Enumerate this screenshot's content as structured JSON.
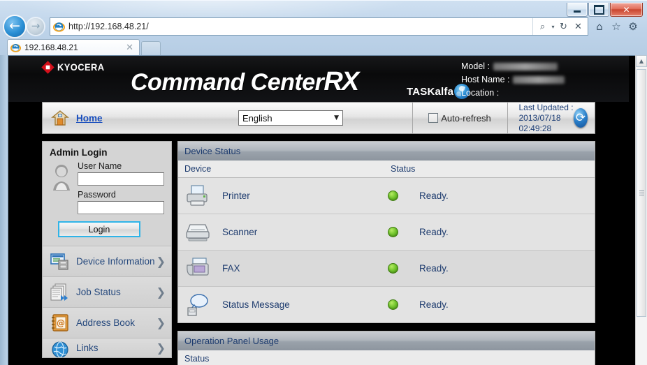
{
  "browser": {
    "window_controls": {
      "minimize": "minimize",
      "maximize": "maximize",
      "close": "✕"
    },
    "back_glyph": "←",
    "forward_glyph": "→",
    "address_value": "http://192.168.48.21/",
    "address_tools": {
      "search": "⌕",
      "dropdown": "▾",
      "refresh": "↻",
      "stop": "✕"
    },
    "toolbar_icons": {
      "home": "⌂",
      "favorites": "☆",
      "settings": "⚙"
    },
    "tab": {
      "title": "192.168.48.21",
      "close": "✕"
    },
    "newtab_label": ""
  },
  "header": {
    "brand": "KYOCERA",
    "product_title": "Command Center",
    "product_rx": "RX",
    "series": "TASKalfa",
    "meta": [
      {
        "label": "Model :",
        "value_redacted": true,
        "redacted_width": 92
      },
      {
        "label": "Host Name :",
        "value_redacted": true,
        "redacted_width": 74
      },
      {
        "label": "Location :",
        "value_redacted": false,
        "redacted_width": 0
      }
    ]
  },
  "toolbar": {
    "home_label": "Home",
    "language_selected": "English",
    "language_caret": "▼",
    "autorefresh_label": "Auto-refresh",
    "autorefresh_checked": false,
    "last_updated_label": "Last Updated :",
    "last_updated_value": "2013/07/18 02:49:28",
    "refresh_glyph": "⟳"
  },
  "sidebar": {
    "login": {
      "title": "Admin Login",
      "username_label": "User Name",
      "username_value": "",
      "password_label": "Password",
      "password_value": "",
      "login_button": "Login"
    },
    "items": [
      {
        "label": "Device Information",
        "icon": "device-information-icon",
        "chevron": "❯"
      },
      {
        "label": "Job Status",
        "icon": "job-status-icon",
        "chevron": "❯"
      },
      {
        "label": "Address Book",
        "icon": "address-book-icon",
        "chevron": "❯"
      },
      {
        "label": "Links",
        "icon": "links-globe-icon",
        "chevron": "❯"
      }
    ]
  },
  "main": {
    "device_status": {
      "section_title": "Device Status",
      "columns": {
        "device": "Device",
        "status": "Status"
      },
      "rows": [
        {
          "device": "Printer",
          "icon": "printer-icon",
          "status": "Ready.",
          "led": "green"
        },
        {
          "device": "Scanner",
          "icon": "scanner-icon",
          "status": "Ready.",
          "led": "green"
        },
        {
          "device": "FAX",
          "icon": "fax-icon",
          "status": "Ready.",
          "led": "green"
        },
        {
          "device": "Status Message",
          "icon": "status-message-icon",
          "status": "Ready.",
          "led": "green"
        }
      ]
    },
    "operation_panel_usage": {
      "section_title": "Operation Panel Usage",
      "status_column": "Status"
    }
  },
  "colors": {
    "link_blue": "#1d3b6e",
    "accent_blue": "#2fb4e8",
    "kyocera_red": "#d5101b",
    "status_green": "#6fc32b"
  }
}
